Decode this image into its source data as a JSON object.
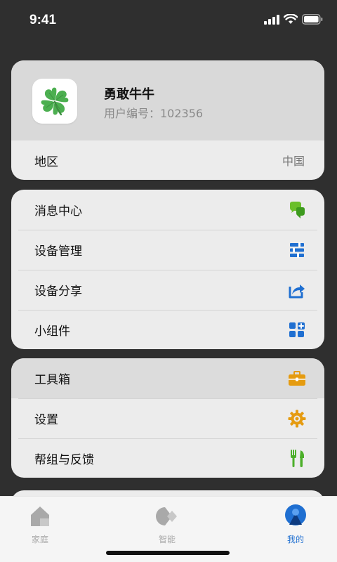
{
  "status_bar": {
    "time": "9:41"
  },
  "profile": {
    "name": "勇敢牛牛",
    "user_id": "用户编号：102356",
    "avatar_icon": "four-leaf-clover-icon"
  },
  "region": {
    "label": "地区",
    "value": "中国"
  },
  "menu_group_1": [
    {
      "label": "消息中心",
      "icon": "message-bubbles-icon",
      "color": "#6abf2a"
    },
    {
      "label": "设备管理",
      "icon": "device-manage-icon",
      "color": "#1f6fd1"
    },
    {
      "label": "设备分享",
      "icon": "share-icon",
      "color": "#1f6fd1"
    },
    {
      "label": "小组件",
      "icon": "widgets-icon",
      "color": "#1f6fd1"
    }
  ],
  "menu_group_2": [
    {
      "label": "工具箱",
      "icon": "toolbox-icon",
      "color": "#e59b10"
    },
    {
      "label": "设置",
      "icon": "settings-gear-icon",
      "color": "#e59b10"
    },
    {
      "label": "帮组与反馈",
      "icon": "help-tools-icon",
      "color": "#4caf2a"
    }
  ],
  "tabs": [
    {
      "label": "家庭",
      "icon": "home-icon",
      "active": false
    },
    {
      "label": "智能",
      "icon": "smart-icon",
      "active": false
    },
    {
      "label": "我的",
      "icon": "profile-icon",
      "active": true
    }
  ],
  "colors": {
    "accent": "#1f6fd1",
    "inactive_tab": "#a9a9a9"
  }
}
